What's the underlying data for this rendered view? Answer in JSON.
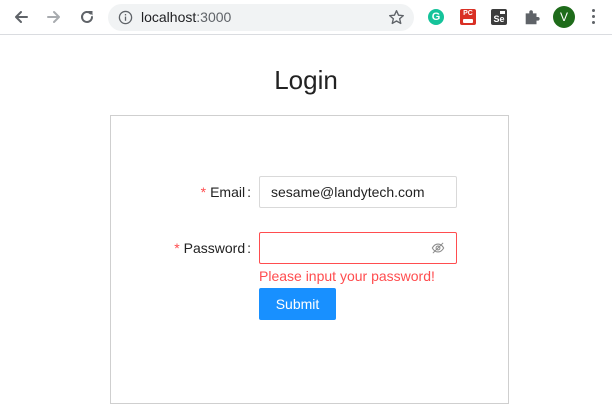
{
  "browser": {
    "url_host": "localhost",
    "url_port": ":3000",
    "profile_initial": "V",
    "extensions": {
      "grammarly_letter": "G",
      "red_ext_text": "PC",
      "selenium_text": "Se"
    },
    "icons": [
      "back-arrow-icon",
      "forward-arrow-icon",
      "reload-icon",
      "info-icon",
      "star-icon",
      "puzzle-icon",
      "more-vert-icon"
    ]
  },
  "page": {
    "title": "Login"
  },
  "form": {
    "email": {
      "required_mark": "*",
      "label": "Email",
      "colon": ":",
      "value": "sesame@landytech.com"
    },
    "password": {
      "required_mark": "*",
      "label": "Password",
      "colon": ":",
      "value": "",
      "error": "Please input your password!",
      "visibility_icon": "eye-invisible-icon"
    },
    "submit_label": "Submit"
  },
  "colors": {
    "primary": "#1890ff",
    "error": "#ff4d4f",
    "avatar": "#1e6b1a",
    "grammarly": "#15c39a"
  }
}
